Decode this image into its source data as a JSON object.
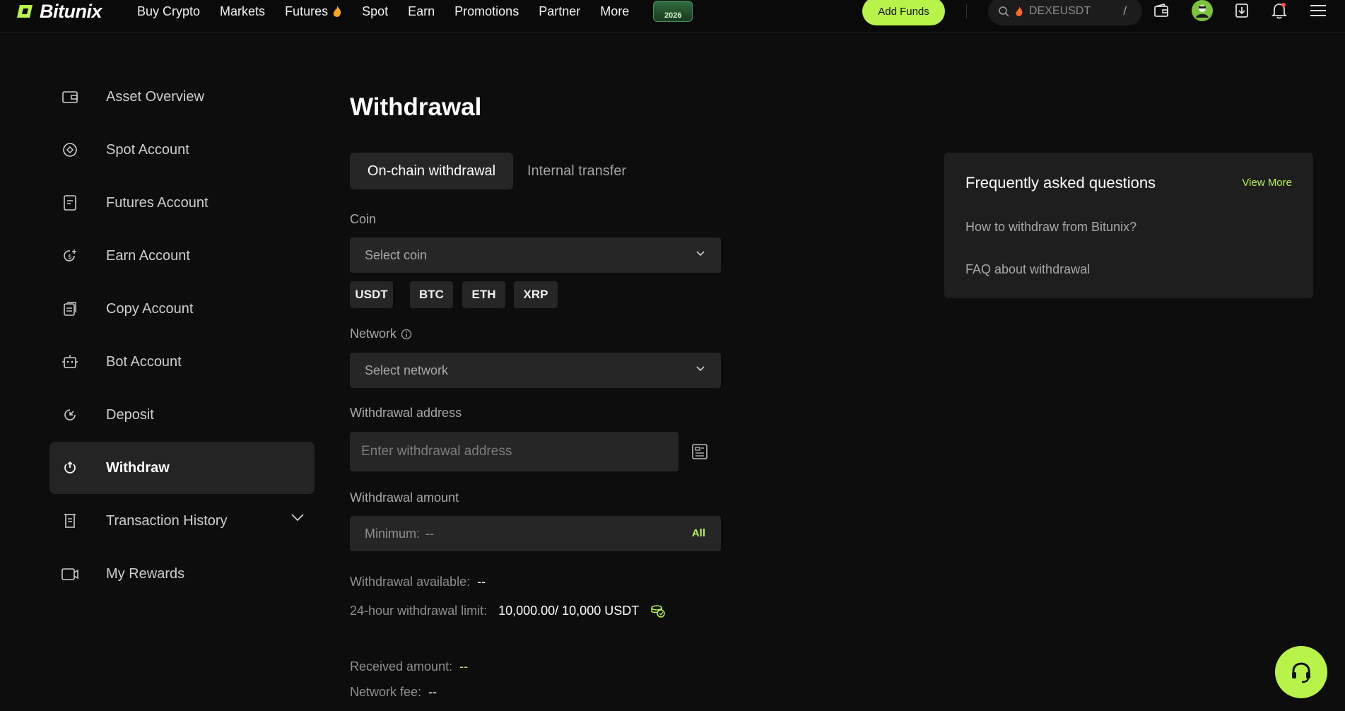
{
  "brand": {
    "name": "Bitunix"
  },
  "nav": {
    "buy_crypto": "Buy Crypto",
    "markets": "Markets",
    "futures": "Futures",
    "spot": "Spot",
    "earn": "Earn",
    "promotions": "Promotions",
    "partner": "Partner",
    "more": "More",
    "badge_year": "2026"
  },
  "header": {
    "add_funds": "Add Funds",
    "search_text": "DEXEUSDT",
    "search_shortcut": "/"
  },
  "sidebar": {
    "items": [
      {
        "label": "Asset Overview"
      },
      {
        "label": "Spot Account"
      },
      {
        "label": "Futures Account"
      },
      {
        "label": "Earn Account"
      },
      {
        "label": "Copy Account"
      },
      {
        "label": "Bot Account"
      },
      {
        "label": "Deposit"
      },
      {
        "label": "Withdraw"
      },
      {
        "label": "Transaction History"
      },
      {
        "label": "My Rewards"
      }
    ],
    "active_index": 7
  },
  "main": {
    "title": "Withdrawal",
    "tabs": [
      {
        "label": "On-chain withdrawal",
        "active": true
      },
      {
        "label": "Internal transfer",
        "active": false
      }
    ],
    "coin_label": "Coin",
    "coin_placeholder": "Select coin",
    "coin_chips": [
      "USDT",
      "BTC",
      "ETH",
      "XRP"
    ],
    "network_label": "Network",
    "network_placeholder": "Select network",
    "address_label": "Withdrawal address",
    "address_placeholder": "Enter withdrawal address",
    "amount_label": "Withdrawal amount",
    "amount_min_label": "Minimum:",
    "amount_min_value": "--",
    "amount_all": "All",
    "available_label": "Withdrawal available:",
    "available_value": "--",
    "limit_label": "24-hour withdrawal limit:",
    "limit_value": "10,000.00/ 10,000 USDT",
    "received_label": "Received amount:",
    "received_value": "--",
    "fee_label": "Network fee:",
    "fee_value": "--"
  },
  "faq": {
    "title": "Frequently asked questions",
    "view_more": "View More",
    "links": [
      "How to withdraw from Bitunix?",
      "FAQ about withdrawal"
    ]
  },
  "colors": {
    "accent": "#b8f34a",
    "background": "#0d0d0d",
    "panel": "#262626"
  }
}
